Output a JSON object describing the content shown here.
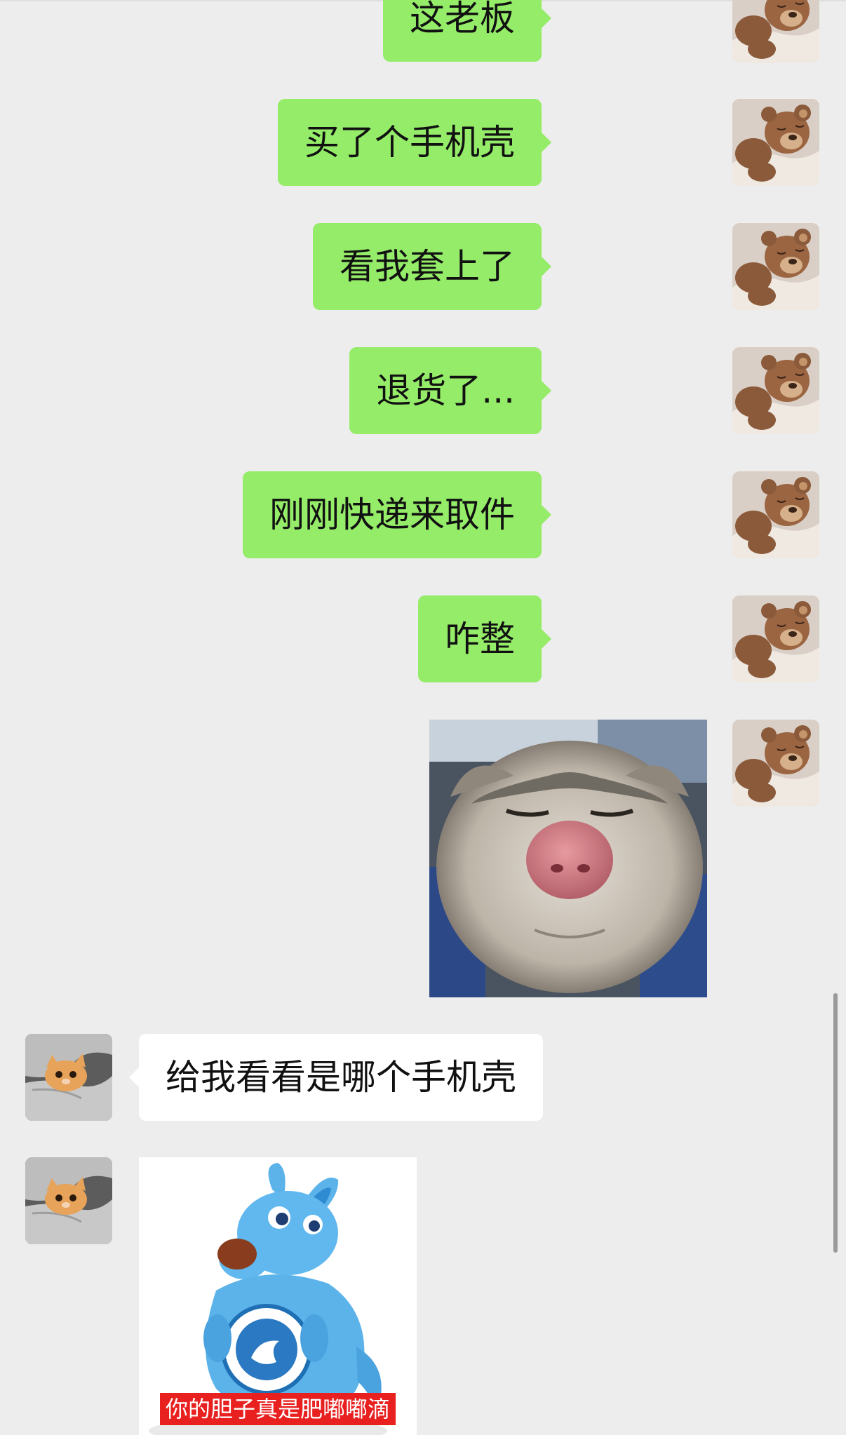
{
  "chat": {
    "messages": [
      {
        "direction": "outgoing",
        "type": "text",
        "text": "这老板"
      },
      {
        "direction": "outgoing",
        "type": "text",
        "text": "买了个手机壳"
      },
      {
        "direction": "outgoing",
        "type": "text",
        "text": "看我套上了"
      },
      {
        "direction": "outgoing",
        "type": "text",
        "text": "退货了..."
      },
      {
        "direction": "outgoing",
        "type": "text",
        "text": "刚刚快递来取件"
      },
      {
        "direction": "outgoing",
        "type": "text",
        "text": "咋整"
      },
      {
        "direction": "outgoing",
        "type": "image",
        "image": "squinting-cat-photo"
      },
      {
        "direction": "incoming",
        "type": "text",
        "text": "给我看看是哪个手机壳"
      },
      {
        "direction": "incoming",
        "type": "sticker",
        "image": "blue-kangaroo-plush-sticker",
        "caption": "你的胆子真是肥嘟嘟滴"
      }
    ],
    "avatars": {
      "self": "teddy-bear-avatar",
      "contact": "kitten-in-hoodie-avatar"
    }
  },
  "colors": {
    "background": "#ededed",
    "outgoing_bubble": "#95ec69",
    "incoming_bubble": "#ffffff",
    "sticker_caption_bg": "#e8201f"
  }
}
